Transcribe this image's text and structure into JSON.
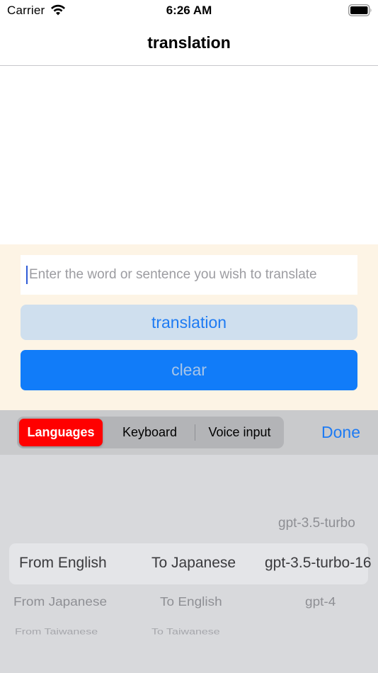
{
  "status_bar": {
    "carrier": "Carrier",
    "time": "6:26 AM"
  },
  "nav": {
    "title": "translation"
  },
  "input": {
    "placeholder": "Enter the word or sentence you wish to translate"
  },
  "buttons": {
    "translate_label": "translation",
    "clear_label": "clear"
  },
  "toolbar": {
    "segments": [
      "Languages",
      "Keyboard",
      "Voice input"
    ],
    "selected_segment": "Languages",
    "done_label": "Done"
  },
  "picker": {
    "row_above": {
      "model": "gpt-3.5-turbo"
    },
    "selected": {
      "from": "From English",
      "to": "To Japanese",
      "model": "gpt-3.5-turbo-16"
    },
    "row_below_1": {
      "from": "From Japanese",
      "to": "To English",
      "model": "gpt-4"
    },
    "row_below_2": {
      "from": "From Taiwanese",
      "to": "To Taiwanese"
    }
  },
  "colors": {
    "accent": "#1e7bf3",
    "selected_segment": "#ff0000",
    "panel_background": "#fdf4e5",
    "clear_button": "#117cf9",
    "translate_button": "#cfdfee"
  }
}
